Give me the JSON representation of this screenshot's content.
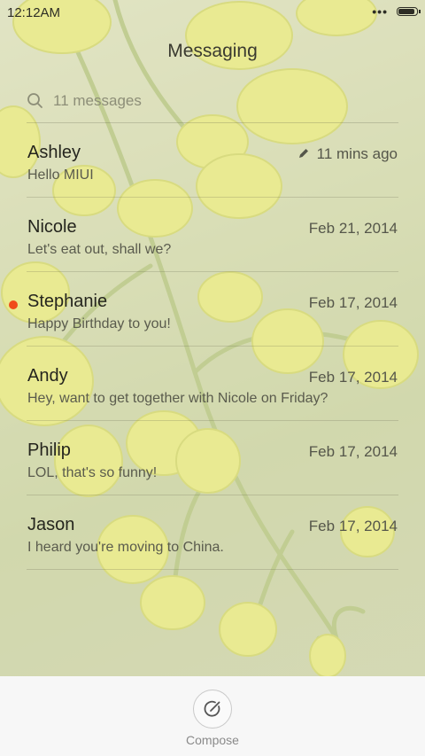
{
  "status_bar": {
    "time": "12:12AM",
    "overflow": "•••"
  },
  "header": {
    "title": "Messaging"
  },
  "search": {
    "placeholder": "11 messages"
  },
  "threads": [
    {
      "name": "Ashley",
      "date": "11 mins ago",
      "preview": "Hello MIUI",
      "draft": true,
      "unread": false
    },
    {
      "name": "Nicole",
      "date": "Feb 21, 2014",
      "preview": "Let's eat out, shall we?",
      "draft": false,
      "unread": false
    },
    {
      "name": "Stephanie",
      "date": "Feb 17, 2014",
      "preview": "Happy Birthday to you!",
      "draft": false,
      "unread": true
    },
    {
      "name": "Andy",
      "date": "Feb 17, 2014",
      "preview": "Hey, want to get together with Nicole on Friday?",
      "draft": false,
      "unread": false
    },
    {
      "name": "Philip",
      "date": "Feb 17, 2014",
      "preview": "LOL, that's so funny!",
      "draft": false,
      "unread": false
    },
    {
      "name": "Jason",
      "date": "Feb 17, 2014",
      "preview": "I heard you're moving to China.",
      "draft": false,
      "unread": false
    }
  ],
  "bottom_bar": {
    "compose_label": "Compose"
  },
  "colors": {
    "unread_dot": "#f04a1a",
    "bottom_bar": "#f7f7f7"
  }
}
